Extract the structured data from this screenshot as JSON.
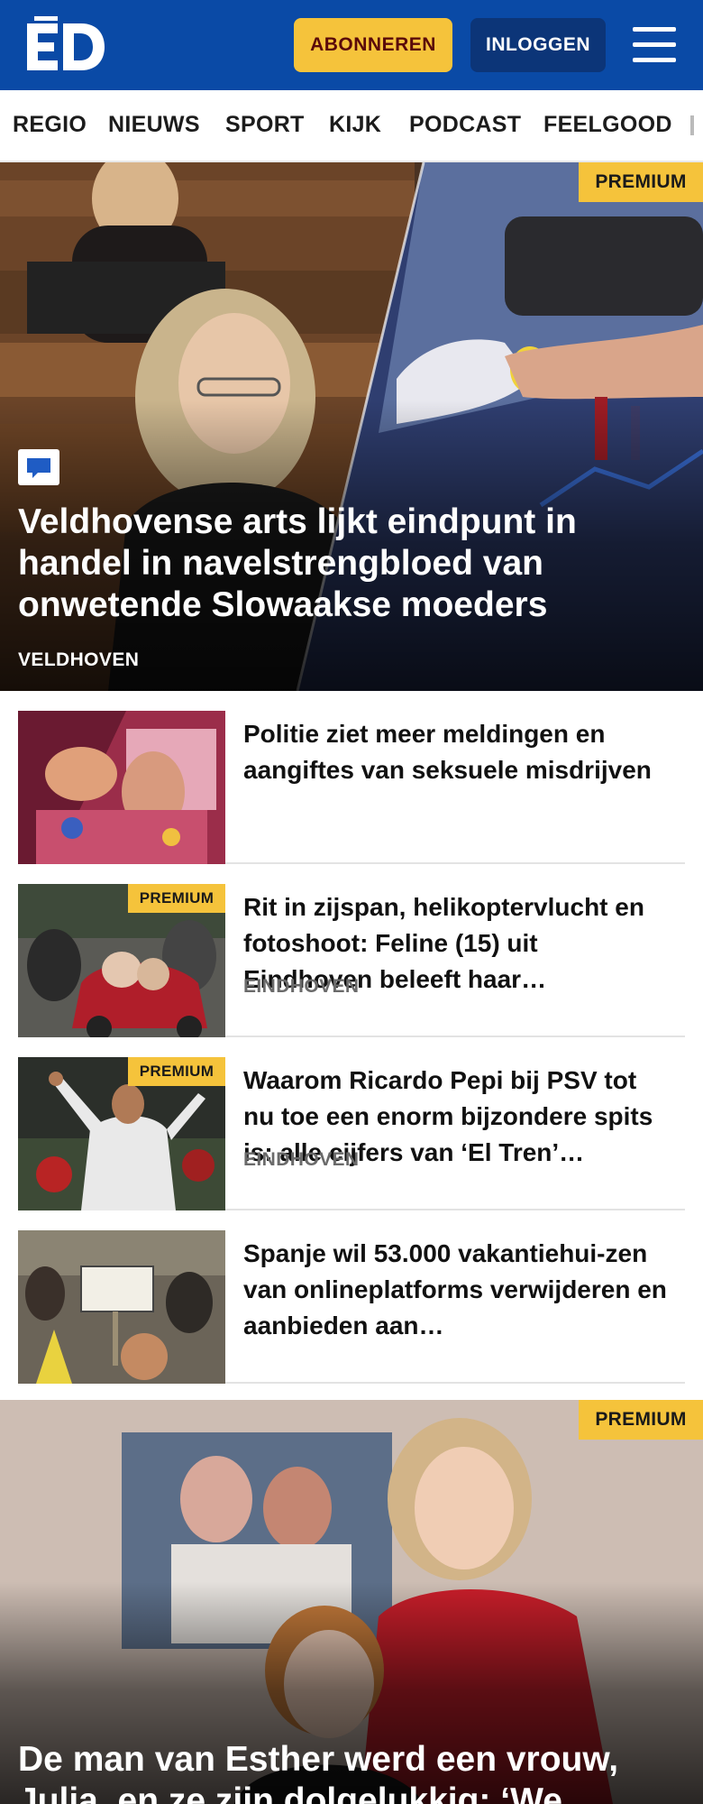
{
  "header": {
    "logo_text": "ED",
    "subscribe_label": "ABONNEREN",
    "login_label": "INLOGGEN",
    "menu_icon": "hamburger-menu-icon",
    "background_color": "#0a4aa6",
    "accent_color": "#f5c33b"
  },
  "nav": {
    "items": [
      "REGIO",
      "NIEUWS",
      "SPORT",
      "KIJK",
      "PODCAST",
      "FEELGOOD"
    ]
  },
  "hero": {
    "badge": "PREMIUM",
    "comment_icon": "comment-icon",
    "title": "Veldhovense arts lijkt eindpunt in handel in navelstrengbloed van onwetende Slowaakse moeders",
    "kicker": "VELDHOVEN"
  },
  "articles": [
    {
      "title": "Politie ziet meer meldingen en aangiftes van seksuele misdrijven",
      "kicker": "",
      "badge": ""
    },
    {
      "title": "Rit in zijspan, helikoptervlucht en fotoshoot: Feline (15) uit Eindhoven beleeft haar…",
      "kicker": "EINDHOVEN",
      "badge": "PREMIUM"
    },
    {
      "title": "Waarom Ricardo Pepi bij PSV tot nu toe een enorm bijzondere spits is: alle cijfers van ‘El Tren’…",
      "kicker": "EINDHOVEN",
      "badge": "PREMIUM"
    },
    {
      "title": "Spanje wil 53.000 vakantiehui-zen van onlineplatforms verwijderen en aanbieden aan…",
      "kicker": "",
      "badge": ""
    }
  ],
  "hero2": {
    "badge": "PREMIUM",
    "title": "De man van Esther werd een vrouw, Julia, en ze zijn dolgelukkig: ‘We…"
  }
}
